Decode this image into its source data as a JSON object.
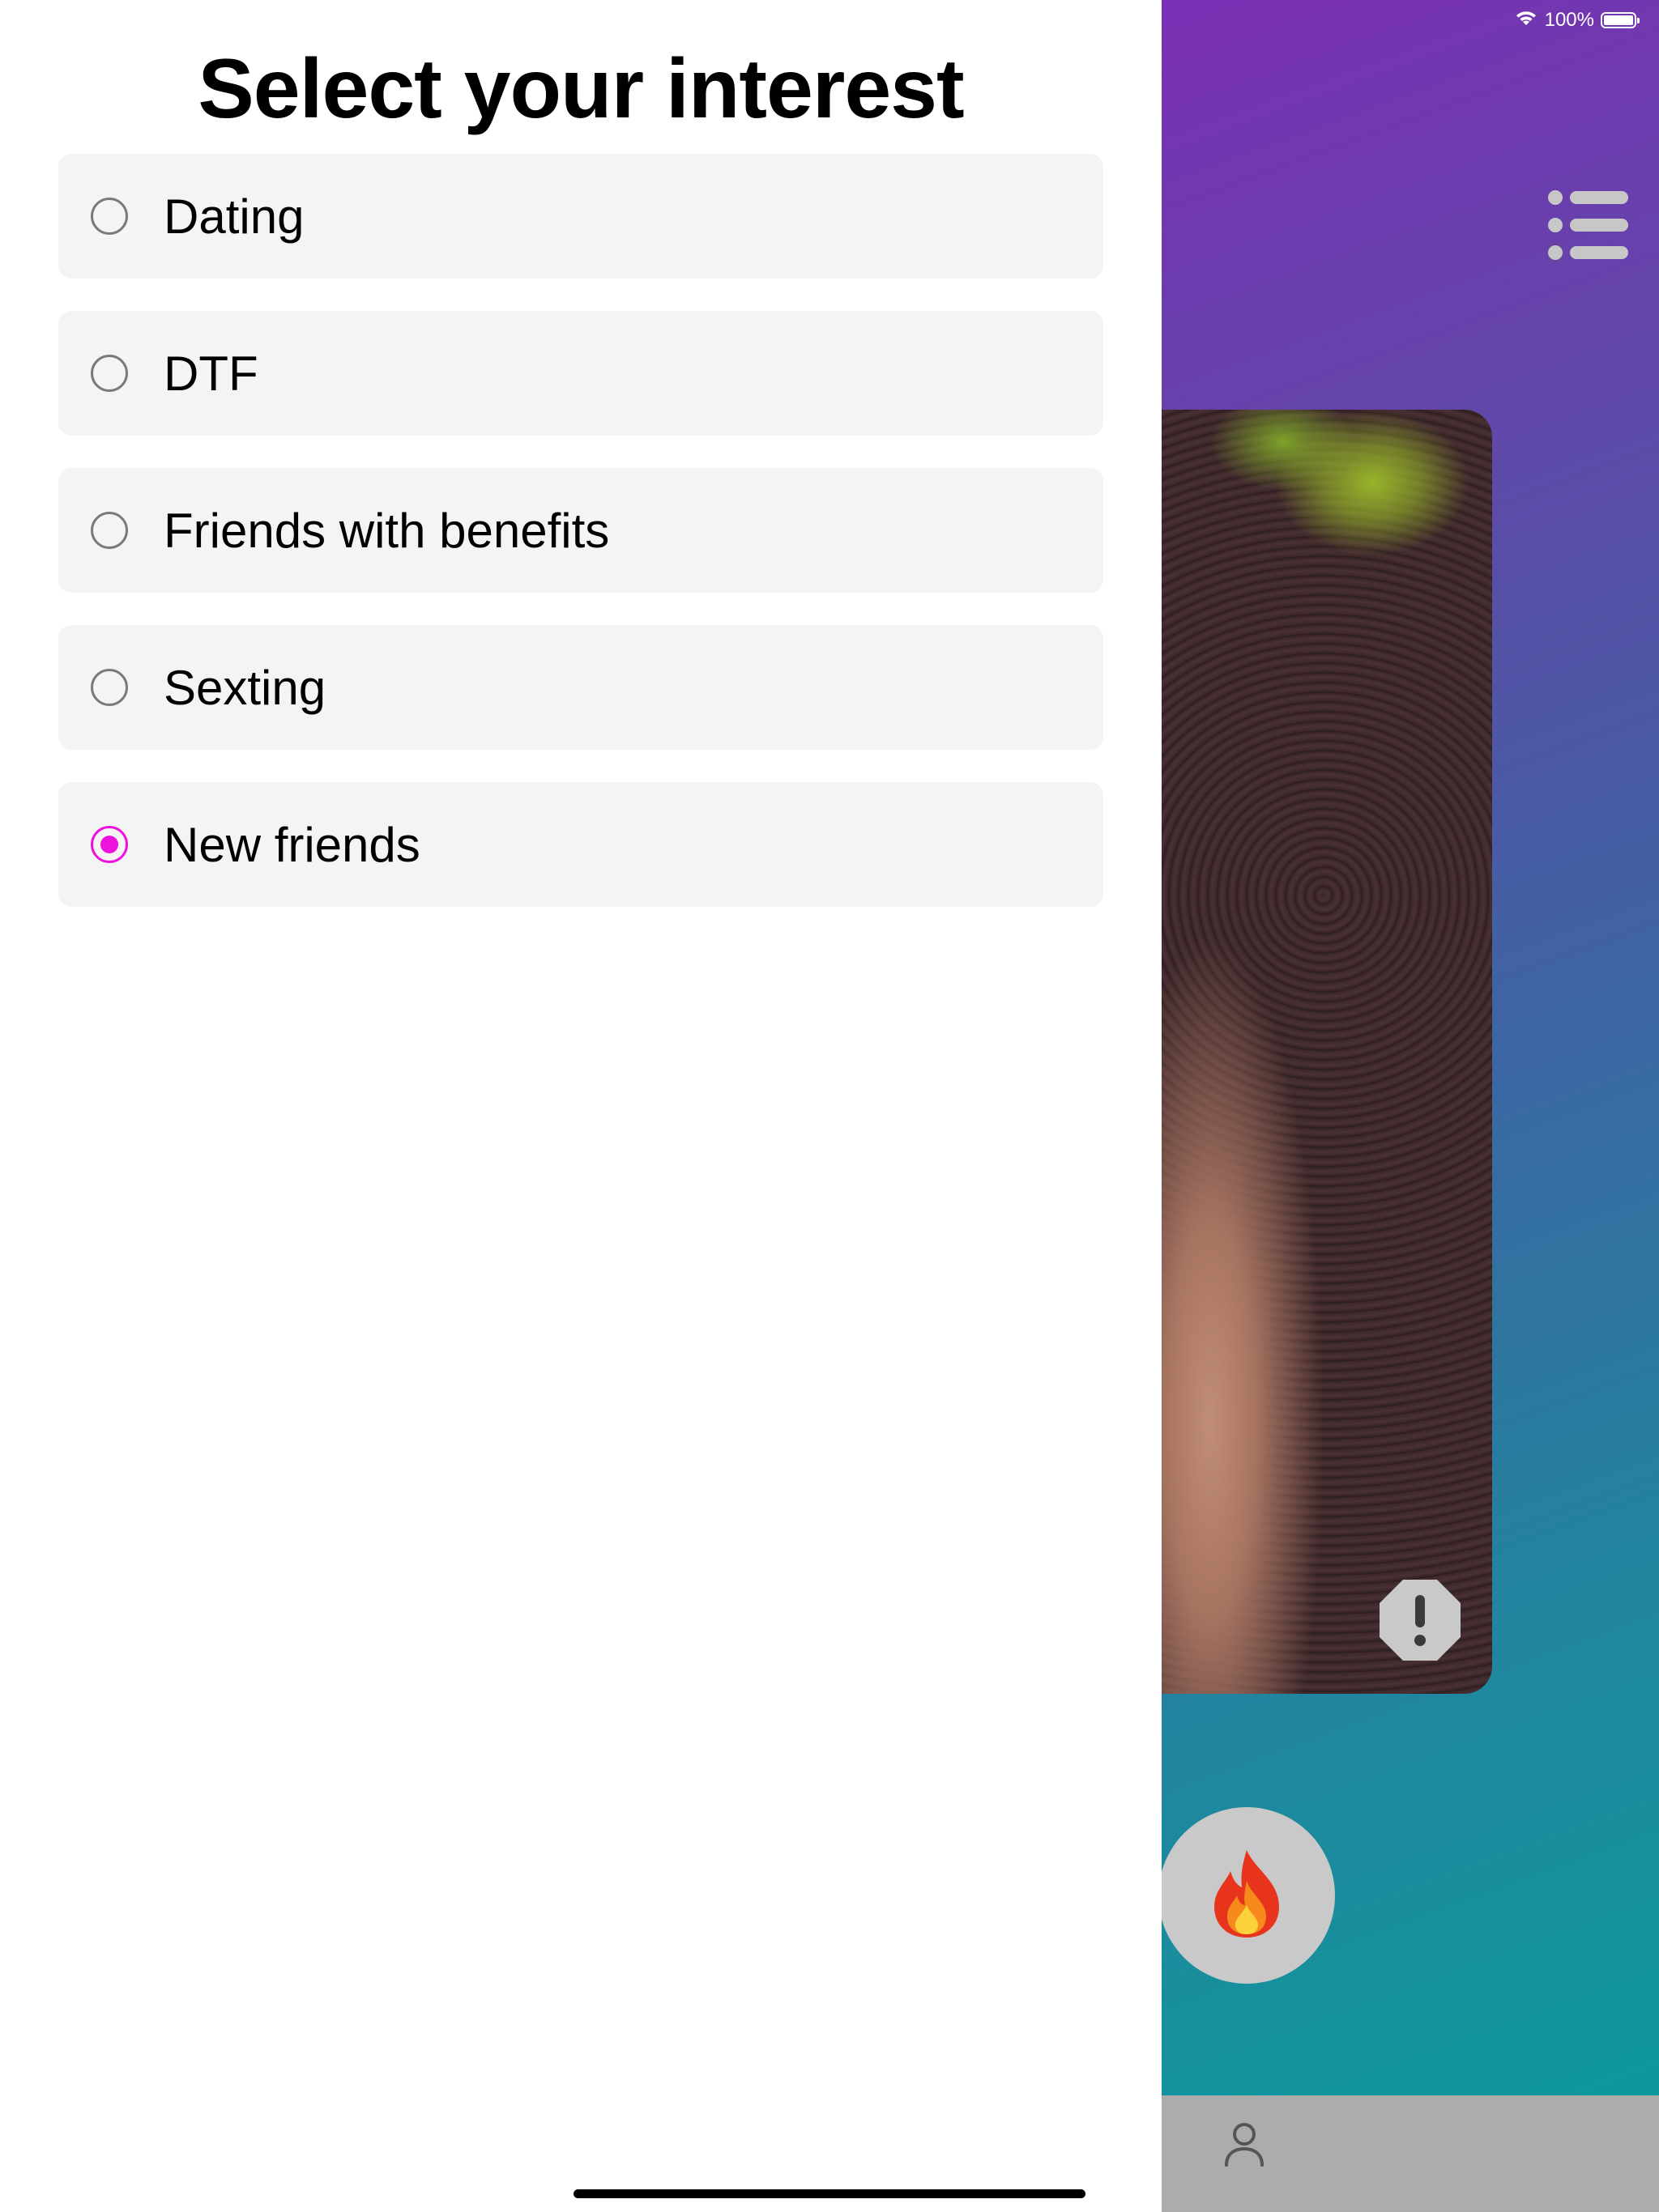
{
  "status_bar": {
    "battery_text": "100%",
    "wifi_icon": "wifi-icon",
    "battery_icon": "battery-icon"
  },
  "sheet": {
    "title": "Select your interest",
    "options": [
      {
        "label": "Dating",
        "selected": false
      },
      {
        "label": "DTF",
        "selected": false
      },
      {
        "label": "Friends with benefits",
        "selected": false
      },
      {
        "label": "Sexting",
        "selected": false
      },
      {
        "label": "New friends",
        "selected": true
      }
    ]
  },
  "background_app": {
    "menu_icon": "list-menu-icon",
    "report_icon": "exclamation-octagon-icon",
    "action_icon": "fire-icon",
    "tab_icon": "person-icon"
  },
  "colors": {
    "accent": "#ee12dd",
    "option_background": "#f4f4f4",
    "gradient_top": "#7b2fb4",
    "gradient_bottom": "#0a9d9c",
    "tab_bar": "#acacac"
  }
}
